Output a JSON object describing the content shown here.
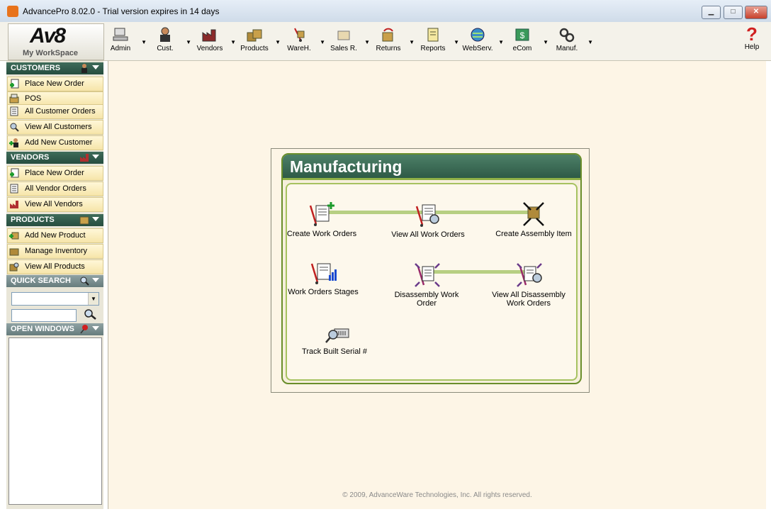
{
  "window": {
    "title": "AdvancePro 8.02.0 - Trial version expires in 14 days",
    "min": "▁",
    "max": "□",
    "close": "✕"
  },
  "logo": {
    "brand": "Av8",
    "workspace": "My WorkSpace"
  },
  "toolbar": {
    "items": [
      {
        "label": "Admin",
        "icon": "admin-computer-icon"
      },
      {
        "label": "Cust.",
        "icon": "customer-person-icon"
      },
      {
        "label": "Vendors",
        "icon": "vendor-factory-icon"
      },
      {
        "label": "Products",
        "icon": "product-boxes-icon"
      },
      {
        "label": "WareH.",
        "icon": "warehouse-handtruck-icon"
      },
      {
        "label": "Sales R.",
        "icon": "sales-return-icon"
      },
      {
        "label": "Returns",
        "icon": "returns-icon"
      },
      {
        "label": "Reports",
        "icon": "reports-icon"
      },
      {
        "label": "WebServ.",
        "icon": "web-service-globe-icon"
      },
      {
        "label": "eCom",
        "icon": "ecom-dollar-icon"
      },
      {
        "label": "Manuf.",
        "icon": "manufacturing-gears-icon"
      }
    ],
    "help_label": "Help"
  },
  "sidebar": {
    "customers": {
      "header": "CUSTOMERS",
      "items": [
        "Place New Order",
        "POS",
        "All Customer Orders",
        "View All Customers",
        "Add New Customer"
      ]
    },
    "vendors": {
      "header": "VENDORS",
      "items": [
        "Place New Order",
        "All Vendor Orders",
        "View All Vendors"
      ]
    },
    "products": {
      "header": "PRODUCTS",
      "items": [
        "Add New Product",
        "Manage Inventory",
        "View All Products"
      ]
    },
    "quick_search": {
      "header": "QUICK SEARCH"
    },
    "open_windows": {
      "header": "OPEN WINDOWS"
    }
  },
  "manufacturing": {
    "title": "Manufacturing",
    "create_work_orders": "Create Work Orders",
    "view_all_work_orders": "View All Work Orders",
    "create_assembly_item": "Create Assembly Item",
    "work_orders_stages": "Work Orders Stages",
    "disassembly_work_order": "Disassembly Work Order",
    "view_all_disassembly": "View All Disassembly Work Orders",
    "track_built_serial": "Track Built Serial #"
  },
  "footer": {
    "copyright": "© 2009, AdvanceWare Technologies, Inc. All rights reserved."
  },
  "colors": {
    "section_header": "#2e5a46",
    "accent_green": "#6a8e2a",
    "sidebar_item": "#f6e5a9",
    "workspace_bg": "#fdf5e6"
  }
}
